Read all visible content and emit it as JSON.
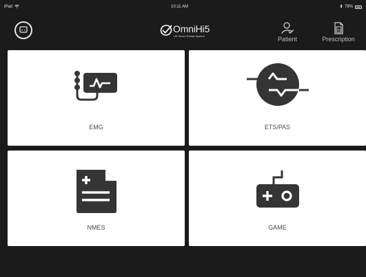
{
  "status_bar": {
    "device": "iPad",
    "time": "10:11 AM",
    "battery": "78%"
  },
  "header": {
    "brand": {
      "title": "OmniHi5",
      "tagline": "UE Neuro Rehab System"
    },
    "nav": [
      {
        "label": "Patient",
        "icon": "person-check-icon"
      },
      {
        "label": "Prescription",
        "icon": "rx-document-icon"
      }
    ]
  },
  "tiles": [
    {
      "label": "EMG",
      "icon": "emg-sensor-icon"
    },
    {
      "label": "ETS/PAS",
      "icon": "ets-pas-signal-icon"
    },
    {
      "label": "NMES",
      "icon": "nmes-document-icon"
    },
    {
      "label": "GAME",
      "icon": "game-controller-icon"
    }
  ],
  "colors": {
    "background": "#1b1b1b",
    "tile_background": "#ffffff",
    "icon_dark": "#353535",
    "label_gray": "#4a4a4a"
  }
}
